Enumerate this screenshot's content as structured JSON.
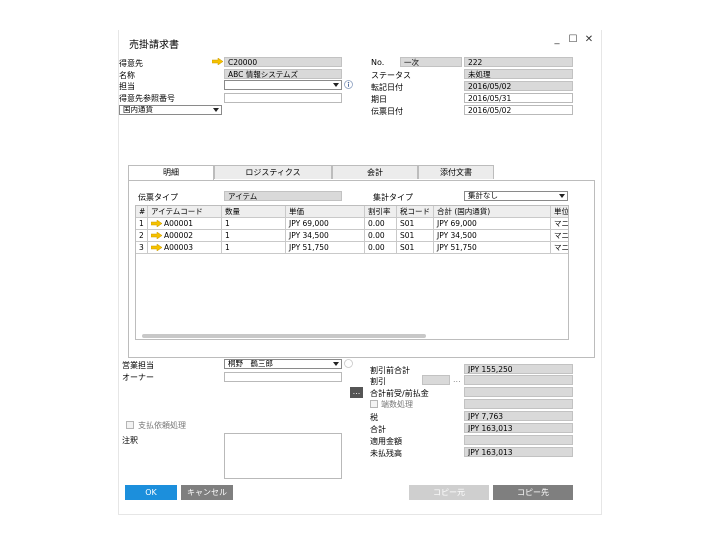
{
  "window": {
    "title": "売掛請求書",
    "minimize": "_",
    "maximize": "☐",
    "close": "✕"
  },
  "header_left": {
    "customer_label": "得意先",
    "customer_value": "C20000",
    "name_label": "名称",
    "name_value": "ABC 情報システムズ",
    "contact_label": "担当",
    "contact_value": "",
    "ref_label": "得意先参照番号",
    "ref_value": "",
    "currency_value": "国内通貨"
  },
  "header_right": {
    "no_label": "No.",
    "series_value": "一次",
    "no_value": "222",
    "status_label": "ステータス",
    "status_value": "未処理",
    "posting_label": "転記日付",
    "posting_value": "2016/05/02",
    "due_label": "期日",
    "due_value": "2016/05/31",
    "doc_date_label": "伝票日付",
    "doc_date_value": "2016/05/02"
  },
  "tabs": [
    {
      "label": "明細"
    },
    {
      "label": "ロジスティクス"
    },
    {
      "label": "会計"
    },
    {
      "label": "添付文書"
    }
  ],
  "contents": {
    "doc_type_label": "伝票タイプ",
    "doc_type_value": "アイテム",
    "summary_label": "集計タイプ",
    "summary_value": "集計なし"
  },
  "grid": {
    "headers": [
      "#",
      "アイテムコード",
      "数量",
      "単価",
      "割引率",
      "税コード",
      "合計 (国内通貨)",
      "単位"
    ],
    "rows": [
      [
        "1",
        "A00001",
        "1",
        "JPY 69,000",
        "0.00",
        "S01",
        "JPY 69,000",
        "マニ"
      ],
      [
        "2",
        "A00002",
        "1",
        "JPY 34,500",
        "0.00",
        "S01",
        "JPY 34,500",
        "マニ"
      ],
      [
        "3",
        "A00003",
        "1",
        "JPY 51,750",
        "0.00",
        "S01",
        "JPY 51,750",
        "マニ"
      ]
    ]
  },
  "footer_left": {
    "sales_emp_label": "営業担当",
    "sales_emp_value": "桐野　鶴三郎",
    "owner_label": "オーナー",
    "owner_value": "",
    "payment_check_label": "支払依頼処理",
    "remarks_label": "注釈"
  },
  "totals": {
    "before_discount_label": "割引前合計",
    "before_discount_value": "JPY 155,250",
    "discount_label": "割引",
    "discount_dots": "...",
    "dp_label": "合計前受/前払金",
    "dp_button": "...",
    "rounding_label": "端数処理",
    "tax_label": "税",
    "tax_value": "JPY 7,763",
    "total_label": "合計",
    "total_value": "JPY 163,013",
    "applied_label": "適用金額",
    "applied_value": "",
    "balance_label": "未払残高",
    "balance_value": "JPY 163,013"
  },
  "buttons": {
    "ok": "OK",
    "cancel": "キャンセル",
    "copy_from": "コピー元",
    "copy_to": "コピー先"
  },
  "colors": {
    "ok": "#1c8fdc",
    "cancel": "#7f7f7f",
    "copy_from": "#cfcfcf",
    "copy_to": "#7f7f7f",
    "arrow": "#f5c100"
  }
}
